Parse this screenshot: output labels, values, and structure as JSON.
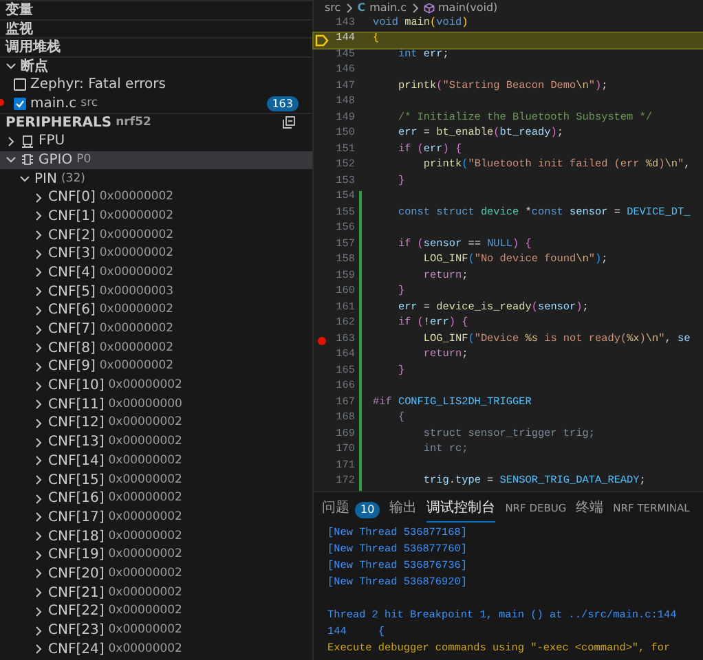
{
  "sidebar": {
    "sections": [
      {
        "label": "变量",
        "expanded": false
      },
      {
        "label": "监视",
        "expanded": false
      },
      {
        "label": "调用堆栈",
        "expanded": false
      },
      {
        "label": "断点",
        "expanded": true
      }
    ],
    "breakpoints": [
      {
        "label": "Zephyr: Fatal errors",
        "checked": false
      },
      {
        "label": "main.c",
        "detail": "src",
        "count": "163",
        "checked": true,
        "dot": true
      }
    ],
    "peripherals": {
      "title": "PERIPHERALS",
      "detail": "nrf52",
      "items": [
        {
          "label": "FPU",
          "expanded": false,
          "selected": false
        },
        {
          "label": "GPIO",
          "detail": "P0",
          "expanded": true,
          "selected": true,
          "children": [
            {
              "label": "PIN",
              "detail": "(32)",
              "expanded": true,
              "selected": false,
              "children": [
                {
                  "label": "CNF[0]",
                  "value": "0x00000002",
                  "expanded": false,
                  "selected": false
                },
                {
                  "label": "CNF[1]",
                  "value": "0x00000002",
                  "expanded": false,
                  "selected": false
                },
                {
                  "label": "CNF[2]",
                  "value": "0x00000002",
                  "expanded": false,
                  "selected": false
                },
                {
                  "label": "CNF[3]",
                  "value": "0x00000002",
                  "expanded": false,
                  "selected": false
                },
                {
                  "label": "CNF[4]",
                  "value": "0x00000002",
                  "expanded": false,
                  "selected": false
                },
                {
                  "label": "CNF[5]",
                  "value": "0x00000003",
                  "expanded": false,
                  "selected": false
                },
                {
                  "label": "CNF[6]",
                  "value": "0x00000002",
                  "expanded": false,
                  "selected": false
                },
                {
                  "label": "CNF[7]",
                  "value": "0x00000002",
                  "expanded": false,
                  "selected": false
                },
                {
                  "label": "CNF[8]",
                  "value": "0x00000002",
                  "expanded": false,
                  "selected": false
                },
                {
                  "label": "CNF[9]",
                  "value": "0x00000002",
                  "expanded": false,
                  "selected": false
                },
                {
                  "label": "CNF[10]",
                  "value": "0x00000002",
                  "expanded": false,
                  "selected": false
                },
                {
                  "label": "CNF[11]",
                  "value": "0x00000000",
                  "expanded": false,
                  "selected": false
                },
                {
                  "label": "CNF[12]",
                  "value": "0x00000002",
                  "expanded": false,
                  "selected": false
                },
                {
                  "label": "CNF[13]",
                  "value": "0x00000002",
                  "expanded": false,
                  "selected": false
                },
                {
                  "label": "CNF[14]",
                  "value": "0x00000002",
                  "expanded": false,
                  "selected": false
                },
                {
                  "label": "CNF[15]",
                  "value": "0x00000002",
                  "expanded": false,
                  "selected": false
                },
                {
                  "label": "CNF[16]",
                  "value": "0x00000002",
                  "expanded": false,
                  "selected": false
                },
                {
                  "label": "CNF[17]",
                  "value": "0x00000002",
                  "expanded": false,
                  "selected": false
                },
                {
                  "label": "CNF[18]",
                  "value": "0x00000002",
                  "expanded": false,
                  "selected": false
                },
                {
                  "label": "CNF[19]",
                  "value": "0x00000002",
                  "expanded": false,
                  "selected": false
                },
                {
                  "label": "CNF[20]",
                  "value": "0x00000002",
                  "expanded": false,
                  "selected": false
                },
                {
                  "label": "CNF[21]",
                  "value": "0x00000002",
                  "expanded": false,
                  "selected": false
                },
                {
                  "label": "CNF[22]",
                  "value": "0x00000002",
                  "expanded": false,
                  "selected": false
                },
                {
                  "label": "CNF[23]",
                  "value": "0x00000002",
                  "expanded": false,
                  "selected": false
                },
                {
                  "label": "CNF[24]",
                  "value": "0x00000002",
                  "expanded": false,
                  "selected": false
                }
              ]
            }
          ]
        }
      ]
    }
  },
  "breadcrumb": [
    {
      "label": "src"
    },
    {
      "label": "main.c",
      "icon_text": "C"
    },
    {
      "label": "main(void)"
    }
  ],
  "editor": {
    "lines": [
      {
        "number": "143",
        "changed": false,
        "current": false,
        "breakpoint": false,
        "tokens": [
          {
            "text": "void ",
            "kind": "kw"
          },
          {
            "text": "main",
            "kind": "fn"
          },
          {
            "text": "(",
            "kind": "b1"
          },
          {
            "text": "void",
            "kind": "kw"
          },
          {
            "text": ")",
            "kind": "b1"
          }
        ]
      },
      {
        "number": "144",
        "changed": false,
        "current": true,
        "breakpoint": false,
        "tokens": [
          {
            "text": "{",
            "kind": "b1"
          }
        ]
      },
      {
        "number": "145",
        "changed": false,
        "current": false,
        "breakpoint": false,
        "tokens": [
          {
            "text": "    int ",
            "kind": "kw"
          },
          {
            "text": "err",
            "kind": "var"
          },
          {
            "text": ";",
            "kind": "p"
          }
        ]
      },
      {
        "number": "146",
        "changed": false,
        "current": false,
        "breakpoint": false
      },
      {
        "number": "147",
        "changed": false,
        "current": false,
        "breakpoint": false,
        "tokens": [
          {
            "text": "    printk",
            "kind": "fn"
          },
          {
            "text": "(",
            "kind": "b2"
          },
          {
            "text": "\"Starting Beacon Demo",
            "kind": "str"
          },
          {
            "text": "\\n",
            "kind": "esc"
          },
          {
            "text": "\"",
            "kind": "str"
          },
          {
            "text": ")",
            "kind": "b2"
          },
          {
            "text": ";",
            "kind": "p"
          }
        ]
      },
      {
        "number": "148",
        "changed": false,
        "current": false,
        "breakpoint": false
      },
      {
        "number": "149",
        "changed": false,
        "current": false,
        "breakpoint": false,
        "tokens": [
          {
            "text": "    /* Initialize the Bluetooth Subsystem */",
            "kind": "cmt"
          }
        ]
      },
      {
        "number": "150",
        "changed": false,
        "current": false,
        "breakpoint": false,
        "tokens": [
          {
            "text": "    err",
            "kind": "var"
          },
          {
            "text": " = ",
            "kind": "p"
          },
          {
            "text": "bt_enable",
            "kind": "fn"
          },
          {
            "text": "(",
            "kind": "b2"
          },
          {
            "text": "bt_ready",
            "kind": "var"
          },
          {
            "text": ")",
            "kind": "b2"
          },
          {
            "text": ";",
            "kind": "p"
          }
        ]
      },
      {
        "number": "151",
        "changed": false,
        "current": false,
        "breakpoint": false,
        "tokens": [
          {
            "text": "    if ",
            "kind": "ctl"
          },
          {
            "text": "(",
            "kind": "b2"
          },
          {
            "text": "err",
            "kind": "var"
          },
          {
            "text": ") ",
            "kind": "b2"
          },
          {
            "text": "{",
            "kind": "b2"
          }
        ]
      },
      {
        "number": "152",
        "changed": false,
        "current": false,
        "breakpoint": false,
        "tokens": [
          {
            "text": "        printk",
            "kind": "fn"
          },
          {
            "text": "(",
            "kind": "b3"
          },
          {
            "text": "\"Bluetooth init failed (err ",
            "kind": "str"
          },
          {
            "text": "%d",
            "kind": "esc"
          },
          {
            "text": ")",
            "kind": "str"
          },
          {
            "text": "\\n",
            "kind": "esc"
          },
          {
            "text": "\"",
            "kind": "str"
          },
          {
            "text": ",",
            "kind": "p"
          }
        ]
      },
      {
        "number": "153",
        "changed": false,
        "current": false,
        "breakpoint": false,
        "tokens": [
          {
            "text": "    }",
            "kind": "b2"
          }
        ]
      },
      {
        "number": "154",
        "changed": true,
        "current": false,
        "breakpoint": false
      },
      {
        "number": "155",
        "changed": true,
        "current": false,
        "breakpoint": false,
        "tokens": [
          {
            "text": "    const struct ",
            "kind": "kw"
          },
          {
            "text": "device",
            "kind": "type"
          },
          {
            "text": " *",
            "kind": "p"
          },
          {
            "text": "const ",
            "kind": "kw"
          },
          {
            "text": "sensor",
            "kind": "var"
          },
          {
            "text": " = ",
            "kind": "p"
          },
          {
            "text": "DEVICE_DT_",
            "kind": "const"
          }
        ]
      },
      {
        "number": "156",
        "changed": true,
        "current": false,
        "breakpoint": false
      },
      {
        "number": "157",
        "changed": true,
        "current": false,
        "breakpoint": false,
        "tokens": [
          {
            "text": "    if ",
            "kind": "ctl"
          },
          {
            "text": "(",
            "kind": "b2"
          },
          {
            "text": "sensor",
            "kind": "var"
          },
          {
            "text": " == ",
            "kind": "p"
          },
          {
            "text": "NULL",
            "kind": "kw"
          },
          {
            "text": ") ",
            "kind": "b2"
          },
          {
            "text": "{",
            "kind": "b2"
          }
        ]
      },
      {
        "number": "158",
        "changed": true,
        "current": false,
        "breakpoint": false,
        "tokens": [
          {
            "text": "        LOG_INF",
            "kind": "fn"
          },
          {
            "text": "(",
            "kind": "b3"
          },
          {
            "text": "\"No device found",
            "kind": "str"
          },
          {
            "text": "\\n",
            "kind": "esc"
          },
          {
            "text": "\"",
            "kind": "str"
          },
          {
            "text": ")",
            "kind": "b3"
          },
          {
            "text": ";",
            "kind": "p"
          }
        ]
      },
      {
        "number": "159",
        "changed": true,
        "current": false,
        "breakpoint": false,
        "tokens": [
          {
            "text": "        return",
            "kind": "ctl"
          },
          {
            "text": ";",
            "kind": "p"
          }
        ]
      },
      {
        "number": "160",
        "changed": true,
        "current": false,
        "breakpoint": false,
        "tokens": [
          {
            "text": "    }",
            "kind": "b2"
          }
        ]
      },
      {
        "number": "161",
        "changed": true,
        "current": false,
        "breakpoint": false,
        "tokens": [
          {
            "text": "    err",
            "kind": "var"
          },
          {
            "text": " = ",
            "kind": "p"
          },
          {
            "text": "device_is_ready",
            "kind": "fn"
          },
          {
            "text": "(",
            "kind": "b2"
          },
          {
            "text": "sensor",
            "kind": "var"
          },
          {
            "text": ")",
            "kind": "b2"
          },
          {
            "text": ";",
            "kind": "p"
          }
        ]
      },
      {
        "number": "162",
        "changed": true,
        "current": false,
        "breakpoint": false,
        "tokens": [
          {
            "text": "    if ",
            "kind": "ctl"
          },
          {
            "text": "(",
            "kind": "b2"
          },
          {
            "text": "!",
            "kind": "p"
          },
          {
            "text": "err",
            "kind": "var"
          },
          {
            "text": ") ",
            "kind": "b2"
          },
          {
            "text": "{",
            "kind": "b2"
          }
        ]
      },
      {
        "number": "163",
        "changed": true,
        "current": false,
        "breakpoint": true,
        "tokens": [
          {
            "text": "        LOG_INF",
            "kind": "fn"
          },
          {
            "text": "(",
            "kind": "b3"
          },
          {
            "text": "\"Device ",
            "kind": "str"
          },
          {
            "text": "%s",
            "kind": "esc"
          },
          {
            "text": " is not ready(",
            "kind": "str"
          },
          {
            "text": "%x",
            "kind": "esc"
          },
          {
            "text": ")",
            "kind": "str"
          },
          {
            "text": "\\n",
            "kind": "esc"
          },
          {
            "text": "\"",
            "kind": "str"
          },
          {
            "text": ", ",
            "kind": "p"
          },
          {
            "text": "se",
            "kind": "var"
          }
        ]
      },
      {
        "number": "164",
        "changed": true,
        "current": false,
        "breakpoint": false,
        "tokens": [
          {
            "text": "        return",
            "kind": "ctl"
          },
          {
            "text": ";",
            "kind": "p"
          }
        ]
      },
      {
        "number": "165",
        "changed": true,
        "current": false,
        "breakpoint": false,
        "tokens": [
          {
            "text": "    }",
            "kind": "b2"
          }
        ]
      },
      {
        "number": "166",
        "changed": true,
        "current": false,
        "breakpoint": false
      },
      {
        "number": "167",
        "changed": true,
        "current": false,
        "breakpoint": false,
        "tokens": [
          {
            "text": "#if ",
            "kind": "pre"
          },
          {
            "text": "CONFIG_LIS2DH_TRIGGER",
            "kind": "const"
          }
        ]
      },
      {
        "number": "168",
        "changed": true,
        "current": false,
        "breakpoint": false,
        "tokens": [
          {
            "text": "    {",
            "kind": "dim"
          }
        ]
      },
      {
        "number": "169",
        "changed": true,
        "current": false,
        "breakpoint": false,
        "tokens": [
          {
            "text": "        struct sensor_trigger trig;",
            "kind": "dim"
          }
        ]
      },
      {
        "number": "170",
        "changed": true,
        "current": false,
        "breakpoint": false,
        "tokens": [
          {
            "text": "        int rc;",
            "kind": "dim"
          }
        ]
      },
      {
        "number": "171",
        "changed": true,
        "current": false,
        "breakpoint": false
      },
      {
        "number": "172",
        "changed": true,
        "current": false,
        "breakpoint": false,
        "tokens": [
          {
            "text": "        trig",
            "kind": "var"
          },
          {
            "text": ".",
            "kind": "p"
          },
          {
            "text": "type",
            "kind": "var"
          },
          {
            "text": " = ",
            "kind": "p"
          },
          {
            "text": "SENSOR_TRIG_DATA_READY",
            "kind": "const"
          },
          {
            "text": ";",
            "kind": "p"
          }
        ]
      }
    ]
  },
  "panel": {
    "tabs": [
      {
        "label": "问题",
        "badge": "10",
        "selected": false
      },
      {
        "label": "输出",
        "selected": false
      },
      {
        "label": "调试控制台",
        "selected": true
      },
      {
        "label": "NRF DEBUG",
        "selected": false
      },
      {
        "label": "终端",
        "selected": false
      },
      {
        "label": "NRF TERMINAL",
        "selected": false
      }
    ],
    "console": [
      {
        "text": "[New Thread 536877168]",
        "kind": "info"
      },
      {
        "text": "[New Thread 536877760]",
        "kind": "info"
      },
      {
        "text": "[New Thread 536876736]",
        "kind": "info"
      },
      {
        "text": "[New Thread 536876920]",
        "kind": "info"
      },
      {
        "text": "Thread 2 hit Breakpoint 1, main () at ../src/main.c:144",
        "kind": "info",
        "gap_before": true
      },
      {
        "text": "144\t{",
        "kind": "info"
      },
      {
        "text": "Execute debugger commands using \"-exec <command>\", for",
        "kind": "warn"
      }
    ]
  }
}
